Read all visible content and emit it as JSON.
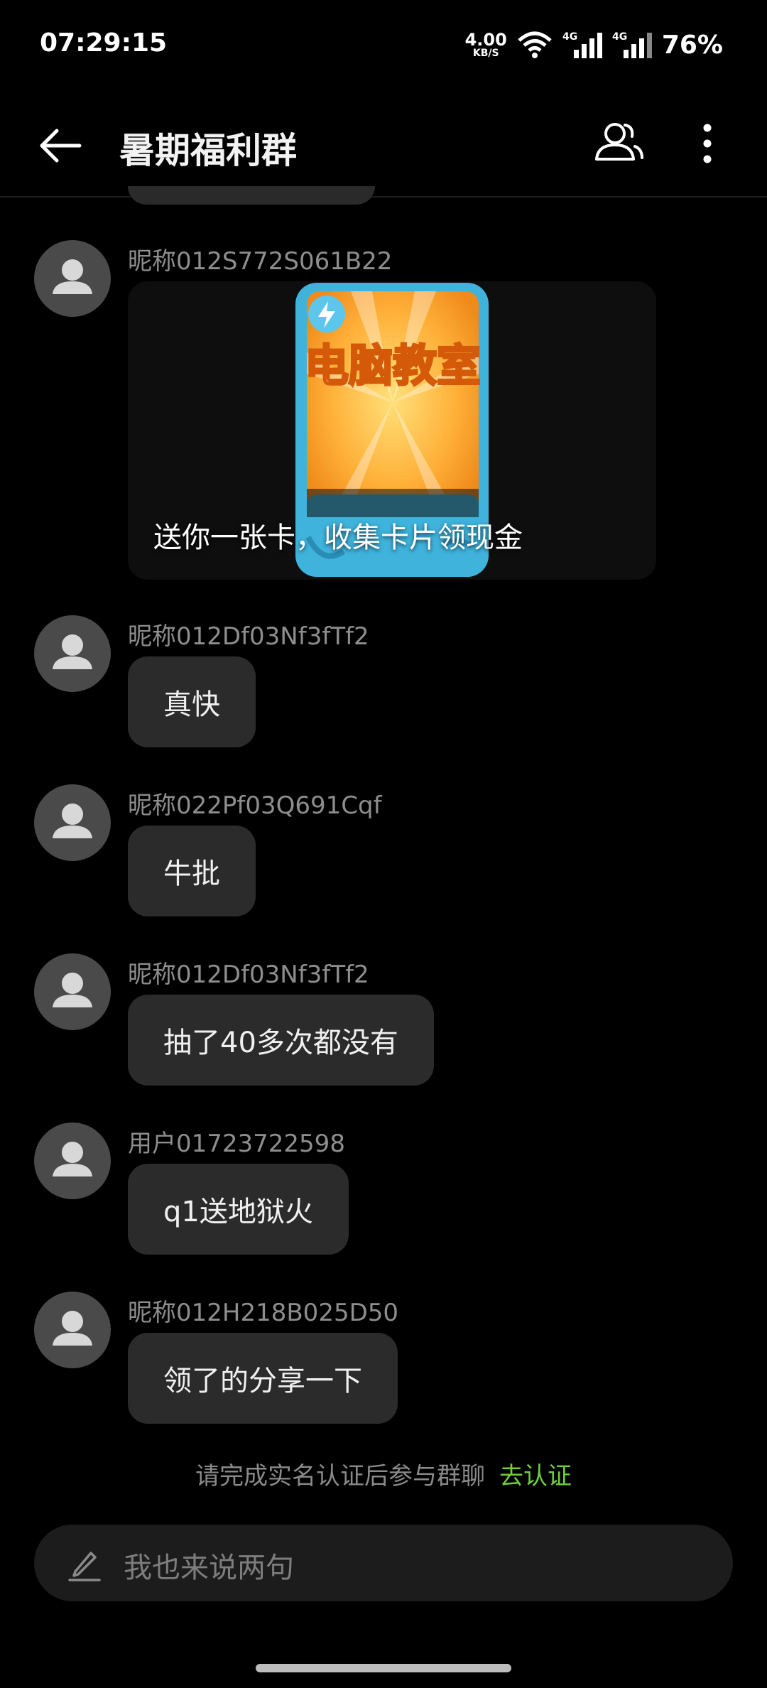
{
  "status": {
    "time": "07:29:15",
    "net_speed_value": "4.00",
    "net_speed_unit": "KB/S",
    "battery": "76%"
  },
  "header": {
    "title": "暑期福利群",
    "icons": [
      "back-arrow-icon",
      "group-members-icon",
      "more-vertical-icon"
    ]
  },
  "messages": [
    {
      "nick": "昵称012S772S061B22",
      "type": "card",
      "card_title": "电脑教室",
      "text": "送你一张卡，收集卡片领现金"
    },
    {
      "nick": "昵称012Df03Nf3fTf2",
      "type": "text",
      "text": "真快"
    },
    {
      "nick": "昵称022Pf03Q691Cqf",
      "type": "text",
      "text": "牛批"
    },
    {
      "nick": "昵称012Df03Nf3fTf2",
      "type": "text",
      "text": "抽了40多次都没有"
    },
    {
      "nick": "用户01723722598",
      "type": "text",
      "text": "q1送地狱火"
    },
    {
      "nick": "昵称012H218B025D50",
      "type": "text",
      "text": "领了的分享一下"
    }
  ],
  "notice": {
    "text": "请完成实名认证后参与群聊",
    "link": "去认证",
    "link_color": "#6fcf3a"
  },
  "input": {
    "placeholder": "我也来说两句"
  }
}
